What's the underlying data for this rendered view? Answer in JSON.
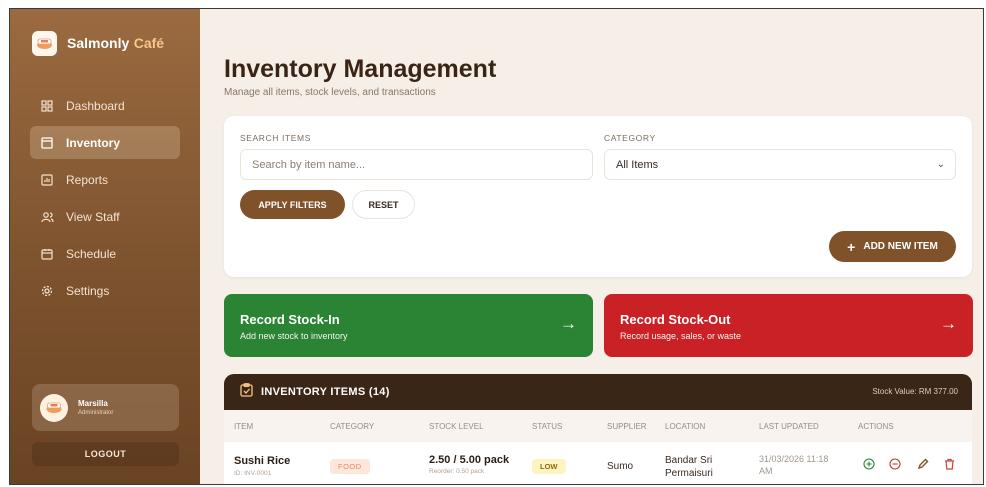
{
  "brand": {
    "name": "Salmonly",
    "accent": "Café"
  },
  "sidebar": {
    "items": [
      {
        "label": "Dashboard",
        "icon": "dashboard-icon"
      },
      {
        "label": "Inventory",
        "icon": "inventory-icon",
        "active": true
      },
      {
        "label": "Reports",
        "icon": "reports-icon"
      },
      {
        "label": "View Staff",
        "icon": "staff-icon"
      },
      {
        "label": "Schedule",
        "icon": "calendar-icon"
      },
      {
        "label": "Settings",
        "icon": "gear-icon"
      }
    ],
    "user": {
      "name": "Marsilla",
      "role": "Administrator"
    },
    "logout_label": "LOGOUT"
  },
  "page": {
    "title": "Inventory Management",
    "subtitle": "Manage all items, stock levels, and transactions"
  },
  "filters": {
    "search_label": "SEARCH ITEMS",
    "search_placeholder": "Search by item name...",
    "category_label": "CATEGORY",
    "category_value": "All Items",
    "apply_label": "APPLY FILTERS",
    "reset_label": "RESET",
    "add_label": "ADD NEW ITEM"
  },
  "stock_actions": {
    "in": {
      "title": "Record Stock-In",
      "subtitle": "Add new stock to inventory"
    },
    "out": {
      "title": "Record Stock-Out",
      "subtitle": "Record usage, sales, or waste"
    }
  },
  "table": {
    "title": "INVENTORY ITEMS (14)",
    "stock_value": "Stock Value: RM 377.00",
    "columns": [
      "ITEM",
      "CATEGORY",
      "STOCK LEVEL",
      "STATUS",
      "SUPPLIER",
      "LOCATION",
      "LAST UPDATED",
      "ACTIONS"
    ],
    "rows": [
      {
        "name": "Sushi Rice",
        "id": "ID: INV-0001",
        "category": "FOOD",
        "stock": "2.50 / 5.00 pack",
        "reorder": "Reorder: 0.50 pack",
        "status": "LOW",
        "supplier": "Sumo",
        "location_line1": "Bandar Sri",
        "location_line2": "Permaisuri",
        "updated_line1": "31/03/2026 11:18",
        "updated_line2": "AM"
      }
    ]
  },
  "colors": {
    "brown": "#80522a",
    "dark_brown": "#3a2616",
    "green": "#2b8434",
    "red": "#c92125"
  }
}
